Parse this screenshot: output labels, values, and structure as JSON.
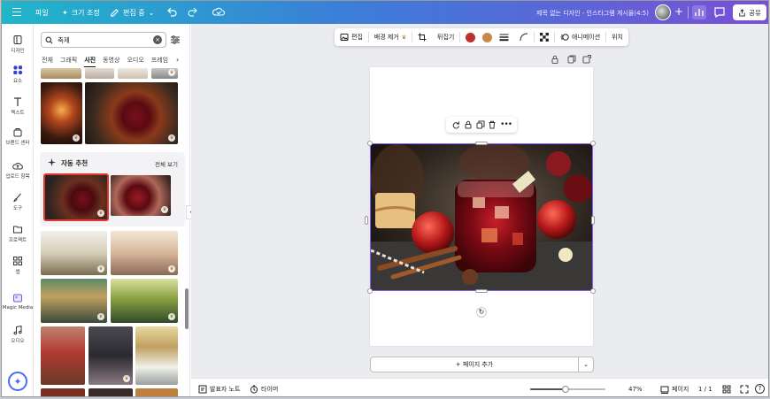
{
  "topbar": {
    "file": "파일",
    "resize": "크기 조정",
    "edit_mode": "편집 중",
    "doc_title": "제목 없는 디자인 - 인스타그램 게시물(4:5)",
    "share": "공유"
  },
  "rail": {
    "items": [
      "디자인",
      "요소",
      "텍스트",
      "브랜드 센터",
      "업로드 항목",
      "도구",
      "프로젝트",
      "앱",
      "Magic Media",
      "오디오"
    ]
  },
  "panel": {
    "search_value": "축제",
    "tabs": [
      "전체",
      "그래픽",
      "사진",
      "동영상",
      "오디오",
      "프레임"
    ],
    "active_tab": "사진",
    "auto_title": "자동 추천",
    "auto_all": "전체 보기"
  },
  "context_toolbar": {
    "edit": "편집",
    "bg_remove": "배경 제거",
    "flip": "뒤집기",
    "animate": "애니메이션",
    "position": "위치",
    "swatch_1": "#c0302f",
    "swatch_2": "#c8874a"
  },
  "canvas": {
    "add_page": "+ 페이지 추가"
  },
  "bottombar": {
    "notes": "발표자 노트",
    "timer": "타이머",
    "zoom": "47%",
    "zoom_level": 0.47,
    "pages": "페이지",
    "page_count": "1 / 1"
  },
  "colors": {
    "accent": "#8b5cf6",
    "brand_gradient_start": "#1fb6c9",
    "brand_gradient_end": "#7a4fd6",
    "selected_thumb": "#e2362f"
  }
}
